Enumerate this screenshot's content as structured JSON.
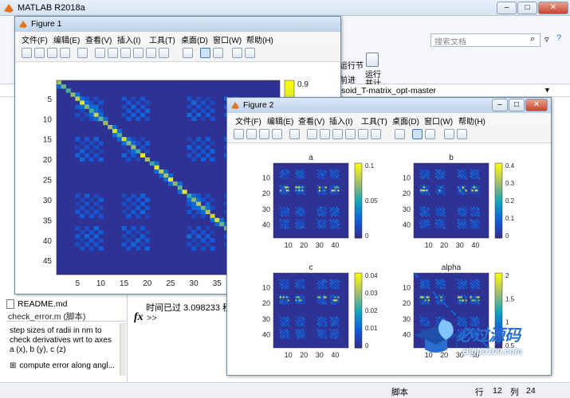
{
  "app": {
    "title": "MATLAB R2018a",
    "search_placeholder": "搜索文档",
    "ribbon": {
      "label_1": "运行节",
      "label_2": "前进",
      "run_time_label": "运行并计时"
    },
    "path": "soid_T-matrix_opt-master",
    "command": {
      "elapsed": "时间已过 3.098233 秒",
      "fx": "fx",
      "prompt": ">>"
    },
    "files": {
      "readme": "README.md"
    },
    "details": {
      "title": "check_error.m  (脚本)",
      "description": "step sizes of radii in nm to check derivatives wrt to axes a (x), b (y), c (z)",
      "function": "compute error along angl..."
    },
    "status": {
      "script": "脚本",
      "row_label": "行",
      "row": "12",
      "col_label": "列",
      "col": "24"
    }
  },
  "figure1": {
    "title": "Figure 1",
    "menu": [
      "文件(F)",
      "编辑(E)",
      "查看(V)",
      "插入(I)",
      "工具(T)",
      "桌面(D)",
      "窗口(W)",
      "帮助(H)"
    ],
    "y_ticks": [
      "5",
      "10",
      "15",
      "20",
      "25",
      "30",
      "35",
      "40",
      "45"
    ],
    "x_ticks": [
      "5",
      "10",
      "15",
      "20",
      "25",
      "30",
      "35"
    ],
    "colorbar_ticks": [
      "0.9"
    ]
  },
  "figure2": {
    "title": "Figure 2",
    "menu": [
      "文件(F)",
      "编辑(E)",
      "查看(V)",
      "插入(I)",
      "工具(T)",
      "桌面(D)",
      "窗口(W)",
      "帮助(H)"
    ],
    "panels": [
      {
        "title": "a",
        "cbar": [
          "0.1",
          "0.05",
          "0"
        ]
      },
      {
        "title": "b",
        "cbar": [
          "0.4",
          "0.3",
          "0.2",
          "0.1",
          "0"
        ]
      },
      {
        "title": "c",
        "cbar": [
          "0.04",
          "0.03",
          "0.02",
          "0.01",
          "0"
        ]
      },
      {
        "title": "alpha",
        "cbar": [
          "2",
          "1.5",
          "1",
          "0.5"
        ]
      }
    ],
    "y_ticks": [
      "10",
      "20",
      "30",
      "40"
    ],
    "x_ticks": [
      "10",
      "20",
      "30",
      "40"
    ]
  },
  "watermark": {
    "title": "必过源码",
    "url": "Bigbo100.com"
  },
  "colors": {
    "accent": "#2a6fd0",
    "heatmap_bg": "#3b2fb0",
    "heatmap_hi": "#f5e62a"
  }
}
